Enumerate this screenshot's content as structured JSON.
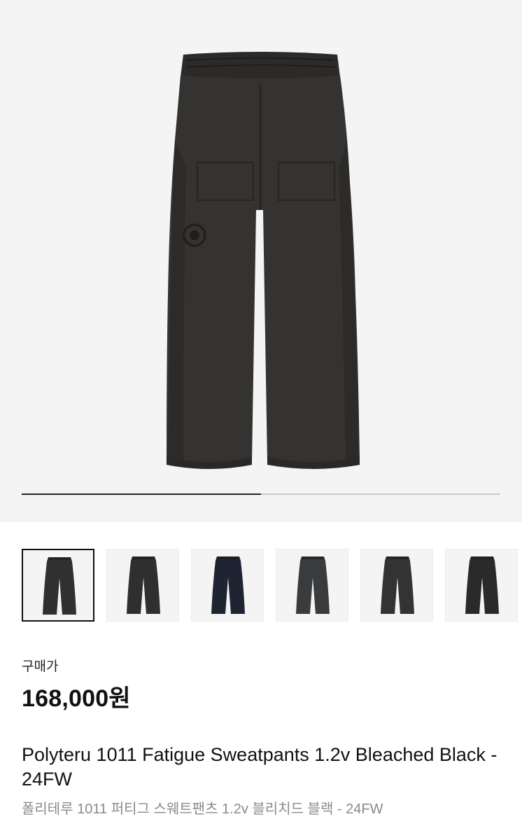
{
  "gallery": {
    "main_image": "product-pants-bleached-black",
    "progress_fraction": 0.5
  },
  "thumbnails": [
    {
      "image": "pants-bleached-black",
      "color": "#303030",
      "selected": true
    },
    {
      "image": "pants-charcoal",
      "color": "#2f2f2f",
      "selected": false
    },
    {
      "image": "pants-navy",
      "color": "#1f2433",
      "selected": false
    },
    {
      "image": "pants-grey",
      "color": "#3a3b3d",
      "selected": false
    },
    {
      "image": "pants-dark-grey",
      "color": "#333333",
      "selected": false
    },
    {
      "image": "pants-black",
      "color": "#2a2a2a",
      "selected": false
    }
  ],
  "product": {
    "price_label": "구매가",
    "price": "168,000원",
    "title_en": "Polyteru 1011 Fatigue Sweatpants 1.2v Bleached Black - 24FW",
    "title_ko": "폴리테루 1011 퍼티그 스웨트팬츠 1.2v 블리치드 블랙 - 24FW"
  },
  "colors": {
    "background": "#ffffff",
    "hero_background": "#f4f4f4",
    "text_primary": "#111111",
    "text_secondary": "#8a8a8a"
  }
}
